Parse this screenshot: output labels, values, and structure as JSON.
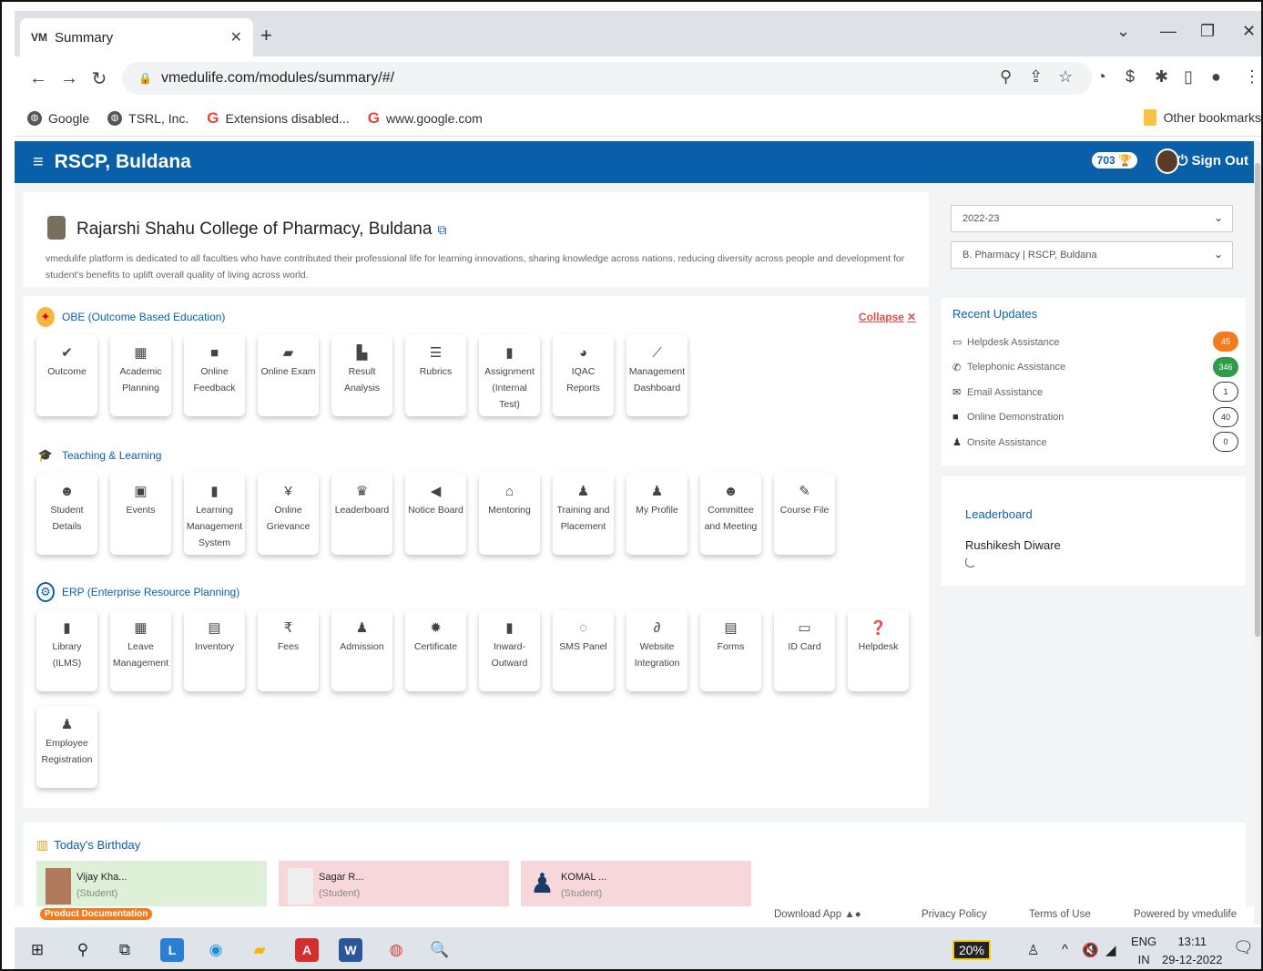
{
  "browser": {
    "tab_title": "Summary",
    "tab_favicon": "VM",
    "url": "vmedulife.com/modules/summary/#/",
    "bookmarks": [
      {
        "label": "Google",
        "icon": "globe-icon"
      },
      {
        "label": "TSRL, Inc.",
        "icon": "globe-icon"
      },
      {
        "label": "Extensions disabled...",
        "icon": "google-g-icon"
      },
      {
        "label": "www.google.com",
        "icon": "google-g-icon"
      }
    ],
    "other_bookmarks": "Other bookmarks"
  },
  "header": {
    "title": "RSCP, Buldana",
    "coins": "703",
    "sign_out": "Sign Out"
  },
  "college": {
    "name": "Rajarshi Shahu College of Pharmacy, Buldana",
    "description": "vmedulife platform is dedicated to all faculties who have contributed their professional life for learning innovations, sharing knowledge across nations, reducing diversity across people and development for student's benefits to uplift overall quality of living across world."
  },
  "filters": {
    "year": "2022-23",
    "program": "B. Pharmacy | RSCP, Buldana"
  },
  "sections": {
    "obe": {
      "title": "OBE (Outcome Based Education)",
      "collapse": "Collapse",
      "tiles": [
        {
          "label": "Outcome",
          "icon": "check-icon"
        },
        {
          "label": "Academic Planning",
          "icon": "calendar-icon"
        },
        {
          "label": "Online Feedback",
          "icon": "comment-icon"
        },
        {
          "label": "Online Exam",
          "icon": "folder-icon"
        },
        {
          "label": "Result Analysis",
          "icon": "bar-chart-icon"
        },
        {
          "label": "Rubrics",
          "icon": "list-icon"
        },
        {
          "label": "Assignment (Internal Test)",
          "icon": "document-icon"
        },
        {
          "label": "IQAC Reports",
          "icon": "pie-chart-icon"
        },
        {
          "label": "Management Dashboard",
          "icon": "line-chart-icon"
        }
      ]
    },
    "teaching": {
      "title": "Teaching & Learning",
      "tiles": [
        {
          "label": "Student Details",
          "icon": "users-icon"
        },
        {
          "label": "Events",
          "icon": "calendar-check-icon"
        },
        {
          "label": "Learning Management System",
          "icon": "book-icon"
        },
        {
          "label": "Online Grievance",
          "icon": "person-icon"
        },
        {
          "label": "Leaderboard",
          "icon": "trophy-icon"
        },
        {
          "label": "Notice Board",
          "icon": "megaphone-icon"
        },
        {
          "label": "Mentoring",
          "icon": "chat-icon"
        },
        {
          "label": "Training and Placement",
          "icon": "user-tie-icon"
        },
        {
          "label": "My Profile",
          "icon": "user-icon"
        },
        {
          "label": "Committee and Meeting",
          "icon": "group-icon"
        },
        {
          "label": "Course File",
          "icon": "edit-file-icon"
        }
      ]
    },
    "erp": {
      "title": "ERP (Enterprise Resource Planning)",
      "tiles": [
        {
          "label": "Library (ILMS)",
          "icon": "library-icon"
        },
        {
          "label": "Leave Management",
          "icon": "calendar-icon"
        },
        {
          "label": "Inventory",
          "icon": "archive-icon"
        },
        {
          "label": "Fees",
          "icon": "rupee-icon"
        },
        {
          "label": "Admission",
          "icon": "user-plus-icon"
        },
        {
          "label": "Certificate",
          "icon": "certificate-icon"
        },
        {
          "label": "Inward-Outward",
          "icon": "file-icon"
        },
        {
          "label": "SMS Panel",
          "icon": "sms-icon"
        },
        {
          "label": "Website Integration",
          "icon": "link-icon"
        },
        {
          "label": "Forms",
          "icon": "form-icon"
        },
        {
          "label": "ID Card",
          "icon": "id-card-icon"
        },
        {
          "label": "Helpdesk",
          "icon": "help-icon"
        },
        {
          "label": "Employee Registration",
          "icon": "employee-icon"
        }
      ]
    }
  },
  "recent_updates": {
    "title": "Recent Updates",
    "items": [
      {
        "label": "Helpdesk Assistance",
        "count": "45",
        "color": "#f27b1f"
      },
      {
        "label": "Telephonic Assistance",
        "count": "346",
        "color": "#2e9b4b"
      },
      {
        "label": "Email Assistance",
        "count": "1",
        "color": "#ffffff"
      },
      {
        "label": "Online Demonstration",
        "count": "40",
        "color": "#ffffff"
      },
      {
        "label": "Onsite Assistance",
        "count": "0",
        "color": "#ffffff"
      }
    ]
  },
  "leaderboard": {
    "title": "Leaderboard",
    "name": "Rushikesh Diware"
  },
  "birthday": {
    "title": "Today's Birthday",
    "people": [
      {
        "name": "Vijay Kha...",
        "role": "(Student)",
        "bg": "#dff0d8"
      },
      {
        "name": "Sagar R...",
        "role": "(Student)",
        "bg": "#f8d7da"
      },
      {
        "name": "KOMAL ...",
        "role": "(Student)",
        "bg": "#f8d7da"
      }
    ]
  },
  "footer": {
    "product_doc": "Product Documentation",
    "download_app": "Download App",
    "privacy": "Privacy Policy",
    "terms": "Terms of Use",
    "powered": "Powered by vmedulife"
  },
  "taskbar": {
    "battery": "20%",
    "lang1": "ENG",
    "lang2": "IN",
    "time": "13:11",
    "date": "29-12-2022"
  },
  "colors": {
    "brand": "#0a60a8",
    "accent_orange": "#f27b1f",
    "accent_green": "#2e9b4b"
  }
}
